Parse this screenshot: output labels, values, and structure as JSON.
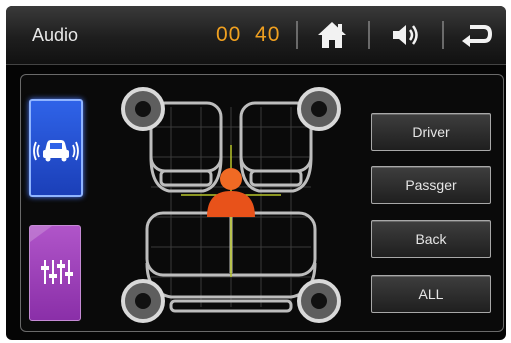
{
  "header": {
    "title": "Audio",
    "time_hours": "00",
    "time_minutes": "40"
  },
  "icons": {
    "home": "home-icon",
    "volume": "volume-icon",
    "back": "return-arrow-icon",
    "car_mode": "car-sound-icon",
    "equalizer": "equalizer-sliders-icon",
    "listener": "listener-person-icon",
    "speaker": "speaker-icon"
  },
  "zone_buttons": [
    "Driver",
    "Passger",
    "Back",
    "ALL"
  ],
  "colors": {
    "time": "#f0a020",
    "car_mode_active": "#2f63e8",
    "eq_mode": "#b055c9",
    "listener": "#e8521a",
    "crosshair": "#b7c42a"
  }
}
